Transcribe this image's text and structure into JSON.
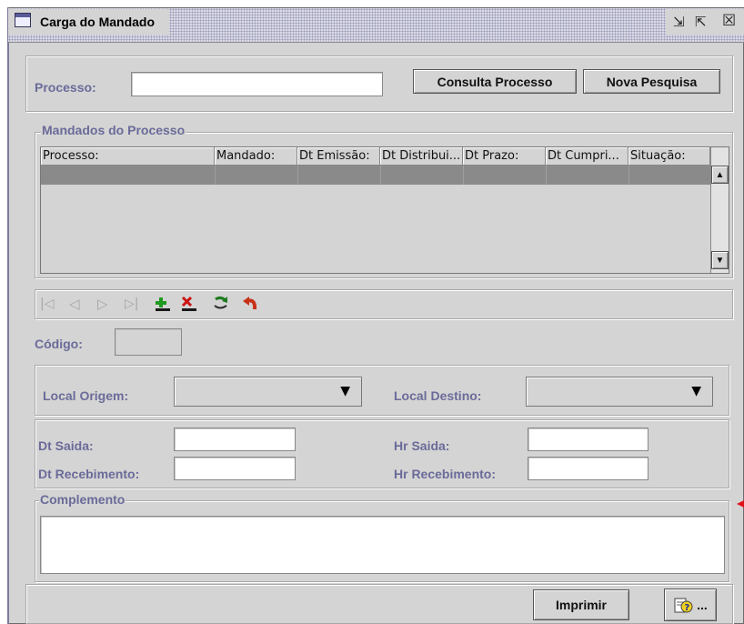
{
  "window": {
    "title": "Carga do Mandado",
    "minimize_glyph": "⇲",
    "maximize_glyph": "⇱",
    "close_glyph": "☒"
  },
  "search": {
    "processo_label": "Processo:",
    "processo_value": "",
    "consulta_button": "Consulta Processo",
    "nova_pesquisa_button": "Nova Pesquisa"
  },
  "mandados": {
    "legend": "Mandados do Processo",
    "columns": [
      "Processo:",
      "Mandado:",
      "Dt Emissão:",
      "Dt Distribui...",
      "Dt Prazo:",
      "Dt Cumpri...",
      "Situação:"
    ],
    "rows": [
      [
        "",
        "",
        "",
        "",
        "",
        "",
        ""
      ]
    ],
    "scroll_up": "▲",
    "scroll_down": "▼"
  },
  "navigator": {
    "first": "|◁",
    "prev": "◁",
    "next": "▷",
    "last": "▷|",
    "icons": [
      "first-record-icon",
      "previous-record-icon",
      "next-record-icon",
      "last-record-icon",
      "add-record-icon",
      "delete-record-icon",
      "refresh-icon",
      "undo-icon"
    ]
  },
  "codigo": {
    "label": "Código:",
    "value": ""
  },
  "locais": {
    "origem_label": "Local Origem:",
    "origem_value": "",
    "destino_label": "Local Destino:",
    "destino_value": "",
    "arrow": "▼"
  },
  "datas": {
    "dt_saida_label": "Dt Saida:",
    "dt_saida_value": "",
    "hr_saida_label": "Hr Saida:",
    "hr_saida_value": "",
    "dt_recebimento_label": "Dt Recebimento:",
    "dt_recebimento_value": "",
    "hr_recebimento_label": "Hr Recebimento:",
    "hr_recebimento_value": ""
  },
  "complemento": {
    "legend": "Complemento",
    "value": ""
  },
  "footer": {
    "imprimir_button": "Imprimir",
    "help_button_suffix": "..."
  },
  "colors": {
    "label": "#6b6b9a",
    "panel": "#d4d4d4",
    "selected_row": "#8a8a8a",
    "add_icon": "#1e9a1e",
    "delete_icon": "#cc1111",
    "side_marker": "#e0101a"
  }
}
